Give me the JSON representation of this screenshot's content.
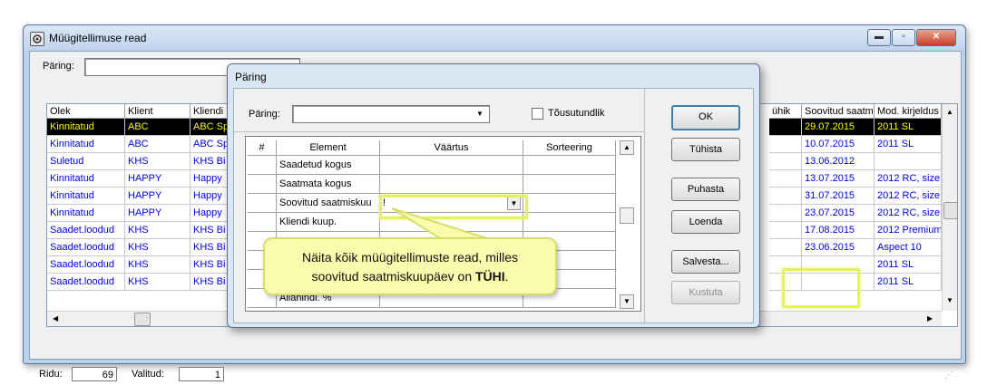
{
  "window": {
    "title": "Müügitellimuse read",
    "controls": {
      "minimize": "▬",
      "maximize": "▫",
      "close": "✕"
    }
  },
  "query_bar": {
    "label": "Päring:",
    "value": ""
  },
  "grid": {
    "left_columns": [
      "Olek",
      "Klient",
      "Kliendi"
    ],
    "right_columns": [
      "ühik",
      "Soovitud saatm",
      "Mod. kirjeldus"
    ],
    "rows": [
      {
        "olek": "Kinnitatud",
        "klient": "ABC",
        "kliendi": "ABC Sp",
        "date": "29.07.2015",
        "mod": "2011 SL",
        "selected": true
      },
      {
        "olek": "Kinnitatud",
        "klient": "ABC",
        "kliendi": "ABC Sp",
        "date": "10.07.2015",
        "mod": "2011 SL"
      },
      {
        "olek": "Suletud",
        "klient": "KHS",
        "kliendi": "KHS Bi",
        "date": "13.06.2012",
        "mod": ""
      },
      {
        "olek": "Kinnitatud",
        "klient": "HAPPY",
        "kliendi": "Happy",
        "date": "13.07.2015",
        "mod": "2012 RC, size"
      },
      {
        "olek": "Kinnitatud",
        "klient": "HAPPY",
        "kliendi": "Happy",
        "date": "31.07.2015",
        "mod": "2012 RC, size"
      },
      {
        "olek": "Kinnitatud",
        "klient": "HAPPY",
        "kliendi": "Happy",
        "date": "23.07.2015",
        "mod": "2012 RC, size"
      },
      {
        "olek": "Saadet.loodud",
        "klient": "KHS",
        "kliendi": "KHS Bi",
        "date": "17.08.2015",
        "mod": "2012 Premium"
      },
      {
        "olek": "Saadet.loodud",
        "klient": "KHS",
        "kliendi": "KHS Bi",
        "date": "23.06.2015",
        "mod": "Aspect 10"
      },
      {
        "olek": "Saadet.loodud",
        "klient": "KHS",
        "kliendi": "KHS Bi",
        "date": "",
        "mod": "2011 SL"
      },
      {
        "olek": "Saadet.loodud",
        "klient": "KHS",
        "kliendi": "KHS Bi",
        "date": "",
        "mod": "2011 SL"
      }
    ]
  },
  "status": {
    "rows_label": "Ridu:",
    "rows_value": "69",
    "selected_label": "Valitud:",
    "selected_value": "1"
  },
  "dialog": {
    "title": "Päring",
    "query_label": "Päring:",
    "query_value": "",
    "ascending_label": "Tõusutundlik",
    "ascending_checked": false,
    "columns": [
      "#",
      "Element",
      "Väärtus",
      "Sorteering"
    ],
    "rows": [
      {
        "element": "Saadetud kogus",
        "value": ""
      },
      {
        "element": "Saatmata kogus",
        "value": ""
      },
      {
        "element": "Soovitud saatmiskuu",
        "value": "!"
      },
      {
        "element": "Kliendi kuup.",
        "value": ""
      },
      {
        "element": "",
        "value": ""
      },
      {
        "element": "",
        "value": ""
      },
      {
        "element": "",
        "value": ""
      },
      {
        "element": "Allahindl. %",
        "value": ""
      }
    ],
    "buttons": {
      "ok": "OK",
      "cancel": "Tühista",
      "clear": "Puhasta",
      "load": "Loenda",
      "save": "Salvesta...",
      "delete": "Kustuta"
    }
  },
  "callout": {
    "line1": "Näita kõik müügitellimuste read, milles",
    "line2_prefix": "soovitud saatmiskuupäev on ",
    "line2_bold": "TÜHI",
    "line2_suffix": "."
  },
  "colors": {
    "highlight": "#e5f25a",
    "callout_bg": "#fbfbae",
    "link_text": "#0000e0",
    "selected_bg": "#000000",
    "selected_text": "#ffff00"
  }
}
